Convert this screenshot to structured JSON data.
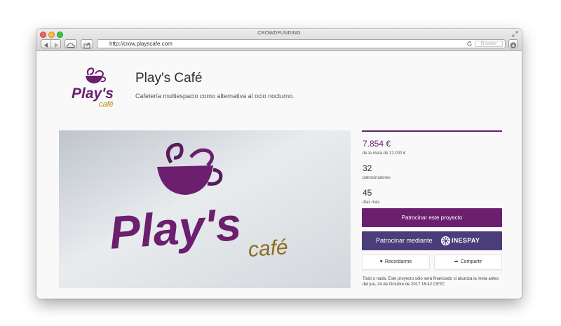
{
  "window": {
    "title": "CROWDFUNDING",
    "url": "http://crow.playscafe.com",
    "reader_label": "Reader"
  },
  "icons": {
    "close": "close-icon",
    "minimize": "minimize-icon",
    "zoom": "zoom-icon",
    "fullscreen": "fullscreen-icon",
    "back": "arrow-left-icon",
    "forward": "arrow-right-icon",
    "cloud": "cloud-icon",
    "share": "share-icon",
    "reload": "reload-icon",
    "download": "download-icon",
    "heart": "heart-icon",
    "share_arrow": "share-arrow-icon"
  },
  "colors": {
    "brand_purple": "#6b1f6e",
    "inespay_purple": "#4b3d79",
    "logo_orange": "#b8860b"
  },
  "project": {
    "logo_text_main": "Play's",
    "logo_text_sub": "café",
    "title": "Play's Café",
    "subtitle": "Cafetería multiespacio como alternativa al ocio nocturno."
  },
  "hero": {
    "logo_text_main": "Play's",
    "logo_text_sub": "café"
  },
  "funding": {
    "amount": "7.854 €",
    "goal": "de la meta de 12.000 €",
    "backers": "32",
    "backers_label": "patrocinadores",
    "days": "45",
    "days_label": "días más",
    "back_button": "Patrocinar este proyecto",
    "inespay_button": "Patrocinar mediante",
    "inespay_brand": "INESPAY",
    "remember_button": "Recordarme",
    "share_button": "Compartir",
    "disclaimer": "Todo o nada. Este proyecto sólo será financiado si alcanza la meta antes del jue, 24 de Octubre de 2017 16:42 CEST."
  }
}
